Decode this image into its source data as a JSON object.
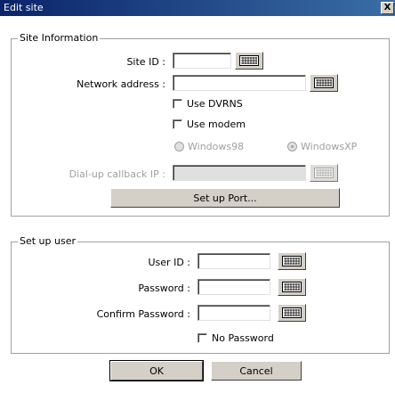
{
  "window": {
    "title": "Edit site",
    "close_glyph": "X"
  },
  "site_info": {
    "legend": "Site Information",
    "site_id_label": "Site ID :",
    "site_id_value": "",
    "network_label": "Network address :",
    "network_value": "",
    "use_dvrns_label": "Use DVRNS",
    "use_modem_label": "Use modem",
    "radio_win98": "Windows98",
    "radio_winxp": "WindowsXP",
    "dialup_label": "Dial-up callback IP :",
    "dialup_value": "",
    "setup_port": "Set up Port..."
  },
  "setup_user": {
    "legend": "Set up user",
    "user_id_label": "User ID :",
    "user_id_value": "",
    "password_label": "Password :",
    "password_value": "",
    "confirm_label": "Confirm Password :",
    "confirm_value": "",
    "no_password_label": "No Password"
  },
  "buttons": {
    "ok": "OK",
    "cancel": "Cancel"
  },
  "icons": {
    "keyboard": "keyboard-icon"
  },
  "colors": {
    "titlebar_start": "#0a246a",
    "titlebar_end": "#3a6ea5",
    "disabled_text": "#a0a0a0"
  }
}
